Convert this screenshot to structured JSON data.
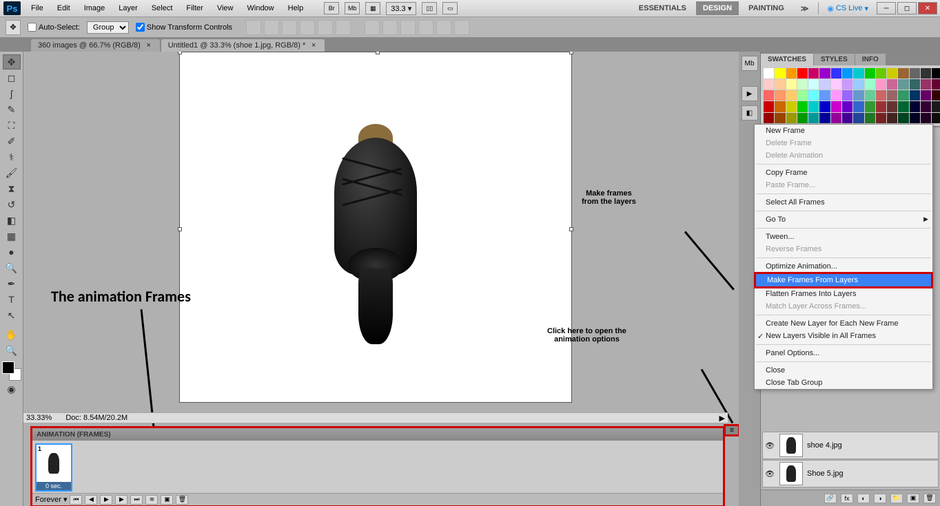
{
  "menu": {
    "items": [
      "File",
      "Edit",
      "Image",
      "Layer",
      "Select",
      "Filter",
      "View",
      "Window",
      "Help"
    ],
    "zoom": "33.3",
    "workspaces": {
      "essentials": "ESSENTIALS",
      "design": "DESIGN",
      "painting": "PAINTING"
    },
    "cslive": "CS Live"
  },
  "options": {
    "autoSelect": "Auto-Select:",
    "autoSelectValue": "Group",
    "showTransform": "Show Transform Controls"
  },
  "docTabs": [
    {
      "label": "360 images @ 66.7% (RGB/8)"
    },
    {
      "label": "Untitled1 @ 33.3% (shoe 1.jpg, RGB/8) *"
    }
  ],
  "status": {
    "zoom": "33.33%",
    "doc": "Doc: 8.54M/20.2M"
  },
  "animation": {
    "title": "ANIMATION (FRAMES)",
    "frame1num": "1",
    "frame1time": "0 sec.",
    "loop": "Forever"
  },
  "rightPanels": {
    "swatches": "SWATCHES",
    "styles": "STYLES",
    "info": "INFO"
  },
  "layers": [
    {
      "name": "shoe 4.jpg"
    },
    {
      "name": "Shoe 5.jpg"
    }
  ],
  "contextMenu": {
    "newFrame": "New Frame",
    "deleteFrame": "Delete Frame",
    "deleteAnimation": "Delete Animation",
    "copyFrame": "Copy Frame",
    "pasteFrame": "Paste Frame...",
    "selectAll": "Select All Frames",
    "goTo": "Go To",
    "tween": "Tween...",
    "reverse": "Reverse Frames",
    "optimize": "Optimize Animation...",
    "makeFrames": "Make Frames From Layers",
    "flatten": "Flatten Frames Into Layers",
    "matchLayer": "Match Layer Across Frames...",
    "createNew": "Create New Layer for Each New Frame",
    "newVisible": "New Layers Visible in All Frames",
    "panelOptions": "Panel Options...",
    "close": "Close",
    "closeGroup": "Close Tab Group"
  },
  "annotations": {
    "frames": "The animation Frames",
    "makeFrames1": "Make frames",
    "makeFrames2": "from the layers",
    "clickHere1": "Click here to open the",
    "clickHere2": "animation options"
  },
  "swatchColors": [
    "#ffffff",
    "#ffff00",
    "#ff9900",
    "#ff0000",
    "#cc0066",
    "#9900cc",
    "#3333ff",
    "#0099ff",
    "#00cccc",
    "#00cc00",
    "#66cc00",
    "#cccc00",
    "#996633",
    "#666666",
    "#333333",
    "#000000",
    "#ffcccc",
    "#ffcc99",
    "#ffff99",
    "#ccffcc",
    "#ccffff",
    "#ccccff",
    "#ffccff",
    "#cc99ff",
    "#99ccff",
    "#99ffcc",
    "#ff99cc",
    "#cc6699",
    "#669999",
    "#336666",
    "#993366",
    "#660033",
    "#ff6666",
    "#ff9966",
    "#ffcc66",
    "#99ff99",
    "#66ffff",
    "#6699ff",
    "#ff99ff",
    "#9966ff",
    "#6699cc",
    "#66cc99",
    "#cc6666",
    "#996666",
    "#339966",
    "#003366",
    "#660066",
    "#330000",
    "#cc0000",
    "#cc6600",
    "#cccc00",
    "#00cc00",
    "#00cccc",
    "#0000cc",
    "#cc00cc",
    "#6600cc",
    "#3366cc",
    "#339933",
    "#993333",
    "#663333",
    "#006633",
    "#000033",
    "#330033",
    "#1a1a1a",
    "#990000",
    "#994400",
    "#999900",
    "#009900",
    "#009999",
    "#000099",
    "#990099",
    "#440099",
    "#224499",
    "#227722",
    "#772222",
    "#442222",
    "#004422",
    "#000022",
    "#220022",
    "#0d0d0d"
  ]
}
